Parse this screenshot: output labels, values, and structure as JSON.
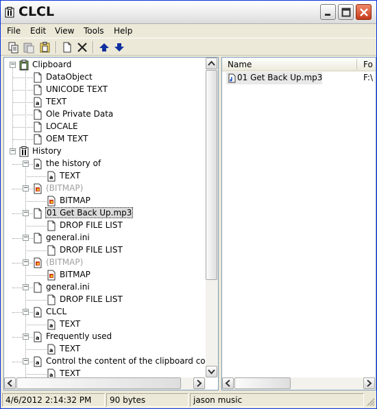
{
  "window": {
    "title": "CLCL"
  },
  "menu": [
    "File",
    "Edit",
    "View",
    "Tools",
    "Help"
  ],
  "tree": [
    {
      "label": "Clipboard",
      "indent": 0,
      "icon": "clipboard-icon",
      "toggle": "-",
      "style": ""
    },
    {
      "label": "DataObject",
      "indent": 1,
      "icon": "document-icon",
      "toggle": "",
      "style": ""
    },
    {
      "label": "UNICODE TEXT",
      "indent": 1,
      "icon": "document-icon",
      "toggle": "",
      "style": ""
    },
    {
      "label": "TEXT",
      "indent": 1,
      "icon": "text-document-icon",
      "toggle": "",
      "style": ""
    },
    {
      "label": "Ole Private Data",
      "indent": 1,
      "icon": "document-icon",
      "toggle": "",
      "style": ""
    },
    {
      "label": "LOCALE",
      "indent": 1,
      "icon": "document-icon",
      "toggle": "",
      "style": ""
    },
    {
      "label": "OEM TEXT",
      "indent": 1,
      "icon": "document-icon",
      "toggle": "",
      "style": ""
    },
    {
      "label": "History",
      "indent": 0,
      "icon": "history-icon",
      "toggle": "-",
      "style": ""
    },
    {
      "label": "the history of",
      "indent": 1,
      "icon": "text-document-icon",
      "toggle": "-",
      "style": ""
    },
    {
      "label": "TEXT",
      "indent": 2,
      "icon": "text-document-icon",
      "toggle": "",
      "style": ""
    },
    {
      "label": "(BITMAP)",
      "indent": 1,
      "icon": "bitmap-icon",
      "toggle": "-",
      "style": "gray"
    },
    {
      "label": "BITMAP",
      "indent": 2,
      "icon": "bitmap-icon",
      "toggle": "",
      "style": ""
    },
    {
      "label": "01 Get Back Up.mp3",
      "indent": 1,
      "icon": "document-icon",
      "toggle": "-",
      "style": "sel"
    },
    {
      "label": "DROP FILE LIST",
      "indent": 2,
      "icon": "document-icon",
      "toggle": "",
      "style": ""
    },
    {
      "label": "general.ini",
      "indent": 1,
      "icon": "document-icon",
      "toggle": "-",
      "style": ""
    },
    {
      "label": "DROP FILE LIST",
      "indent": 2,
      "icon": "document-icon",
      "toggle": "",
      "style": ""
    },
    {
      "label": "(BITMAP)",
      "indent": 1,
      "icon": "bitmap-icon",
      "toggle": "-",
      "style": "gray"
    },
    {
      "label": "BITMAP",
      "indent": 2,
      "icon": "bitmap-icon",
      "toggle": "",
      "style": ""
    },
    {
      "label": "general.ini",
      "indent": 1,
      "icon": "document-icon",
      "toggle": "-",
      "style": ""
    },
    {
      "label": "DROP FILE LIST",
      "indent": 2,
      "icon": "document-icon",
      "toggle": "",
      "style": ""
    },
    {
      "label": "CLCL",
      "indent": 1,
      "icon": "text-document-icon",
      "toggle": "-",
      "style": ""
    },
    {
      "label": "TEXT",
      "indent": 2,
      "icon": "text-document-icon",
      "toggle": "",
      "style": ""
    },
    {
      "label": "Frequently used",
      "indent": 1,
      "icon": "text-document-icon",
      "toggle": "-",
      "style": ""
    },
    {
      "label": "TEXT",
      "indent": 2,
      "icon": "text-document-icon",
      "toggle": "",
      "style": ""
    },
    {
      "label": "Control the content of the clipboard cont",
      "indent": 1,
      "icon": "text-document-icon",
      "toggle": "-",
      "style": ""
    },
    {
      "label": "TEXT",
      "indent": 2,
      "icon": "text-document-icon",
      "toggle": "",
      "style": ""
    }
  ],
  "list": {
    "columns": [
      "Name",
      "Fo"
    ],
    "rows": [
      {
        "name": "01 Get Back Up.mp3",
        "folder": "F:\\"
      }
    ]
  },
  "status": {
    "datetime": "4/6/2012 2:14:32 PM",
    "size": "90 bytes",
    "title": "jason music"
  },
  "colors": {
    "title_bar": "#f2f2f2",
    "close_button": "#c5391a",
    "arrow_blue": "#1030a0"
  }
}
